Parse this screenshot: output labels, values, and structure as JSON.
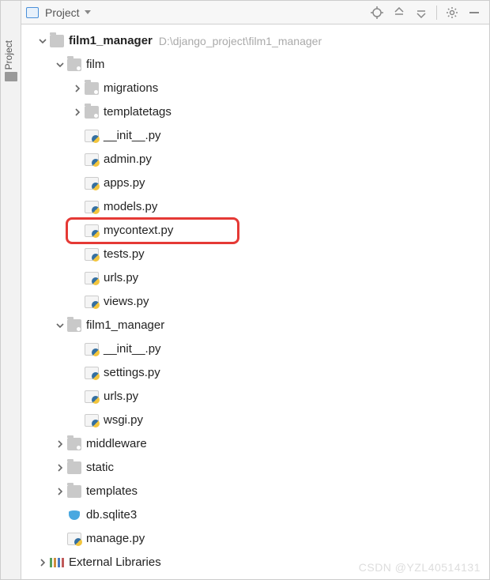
{
  "sidebar": {
    "label": "Project"
  },
  "toolbar": {
    "title": "Project"
  },
  "tree": {
    "root": {
      "name": "film1_manager",
      "path": "D:\\django_project\\film1_manager",
      "children": [
        {
          "name": "film",
          "type": "pkg",
          "expanded": true,
          "children": [
            {
              "name": "migrations",
              "type": "pkg",
              "expanded": false
            },
            {
              "name": "templatetags",
              "type": "pkg",
              "expanded": false
            },
            {
              "name": "__init__.py",
              "type": "py"
            },
            {
              "name": "admin.py",
              "type": "py"
            },
            {
              "name": "apps.py",
              "type": "py"
            },
            {
              "name": "models.py",
              "type": "py"
            },
            {
              "name": "mycontext.py",
              "type": "py",
              "highlight": true
            },
            {
              "name": "tests.py",
              "type": "py"
            },
            {
              "name": "urls.py",
              "type": "py"
            },
            {
              "name": "views.py",
              "type": "py"
            }
          ]
        },
        {
          "name": "film1_manager",
          "type": "pkg",
          "expanded": true,
          "children": [
            {
              "name": "__init__.py",
              "type": "py"
            },
            {
              "name": "settings.py",
              "type": "py"
            },
            {
              "name": "urls.py",
              "type": "py"
            },
            {
              "name": "wsgi.py",
              "type": "py"
            }
          ]
        },
        {
          "name": "middleware",
          "type": "pkg",
          "expanded": false
        },
        {
          "name": "static",
          "type": "dir",
          "expanded": false
        },
        {
          "name": "templates",
          "type": "dir",
          "expanded": false
        },
        {
          "name": "db.sqlite3",
          "type": "db"
        },
        {
          "name": "manage.py",
          "type": "py"
        }
      ]
    },
    "external": "External Libraries"
  },
  "watermark": "CSDN @YZL40514131"
}
